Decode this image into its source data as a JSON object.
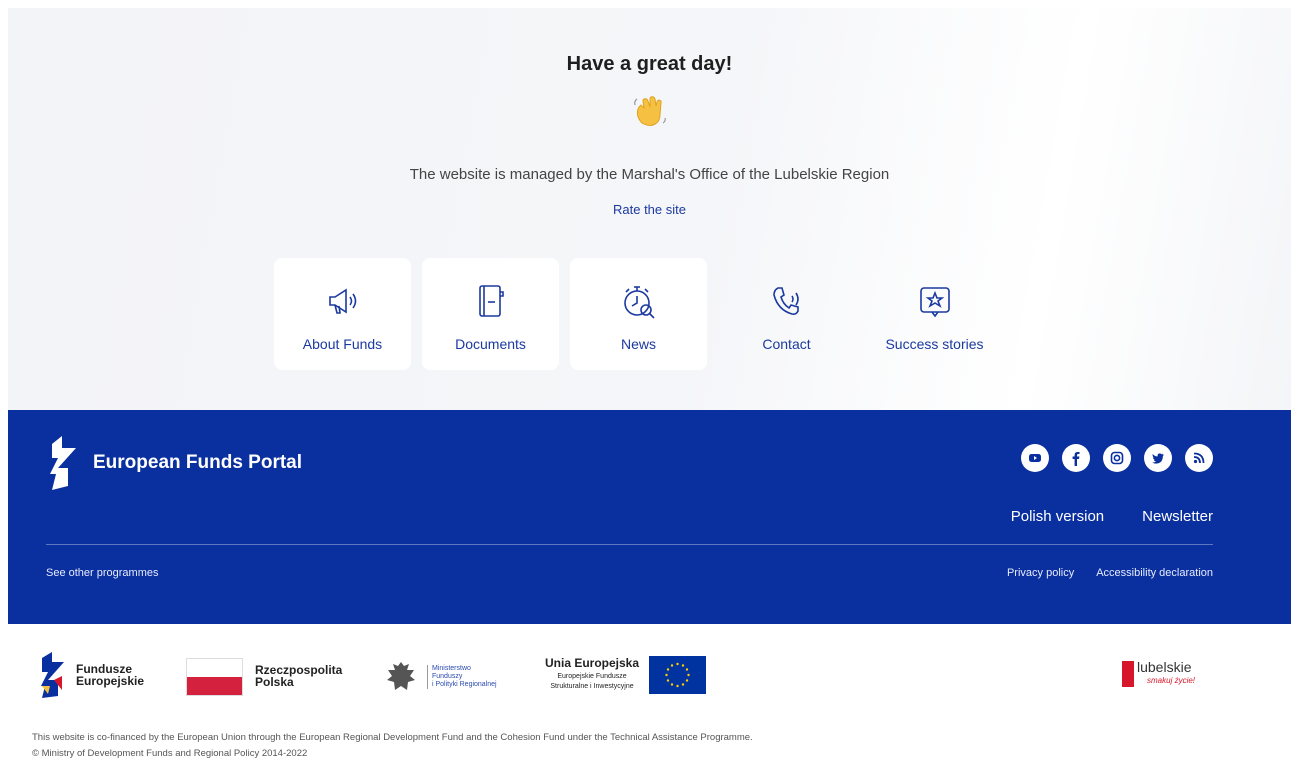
{
  "hero": {
    "greeting": "Have a great day!",
    "wave_icon": "waving-hand-icon",
    "managed_by": "The website is managed by the Marshal's Office of the Lubelskie Region",
    "rate_link": "Rate the site"
  },
  "tiles": [
    {
      "label": "About Funds",
      "icon": "megaphone-icon"
    },
    {
      "label": "Documents",
      "icon": "document-icon"
    },
    {
      "label": "News",
      "icon": "stopwatch-icon"
    },
    {
      "label": "Contact",
      "icon": "phone-icon"
    },
    {
      "label": "Success stories",
      "icon": "star-message-icon"
    }
  ],
  "footer": {
    "portal_title": "European Funds Portal",
    "social": [
      "youtube-icon",
      "facebook-icon",
      "instagram-icon",
      "twitter-icon",
      "rss-icon"
    ],
    "polish_version": "Polish version",
    "newsletter": "Newsletter",
    "other_programmes": "See other programmes",
    "privacy": "Privacy policy",
    "accessibility": "Accessibility declaration",
    "band_color": "#0a2f9e"
  },
  "logos": {
    "fe_line1": "Fundusze",
    "fe_line2": "Europejskie",
    "rp_line1": "Rzeczpospolita",
    "rp_line2": "Polska",
    "min_line1": "Ministerstwo",
    "min_line2": "Funduszy",
    "min_line3": "i Polityki Regionalnej",
    "ue_line1": "Unia Europejska",
    "ue_line2": "Europejskie Fundusze",
    "ue_line3": "Strukturalne i Inwestycyjne",
    "lub_name": "lubelskie",
    "lub_slogan": "smakuj życie!"
  },
  "notes": {
    "line1": "This website is co-financed by the European Union through the European Regional Development Fund and the Cohesion Fund under the Technical Assistance Programme.",
    "line2": "© Ministry of Development Funds and Regional Policy 2014-2022"
  }
}
